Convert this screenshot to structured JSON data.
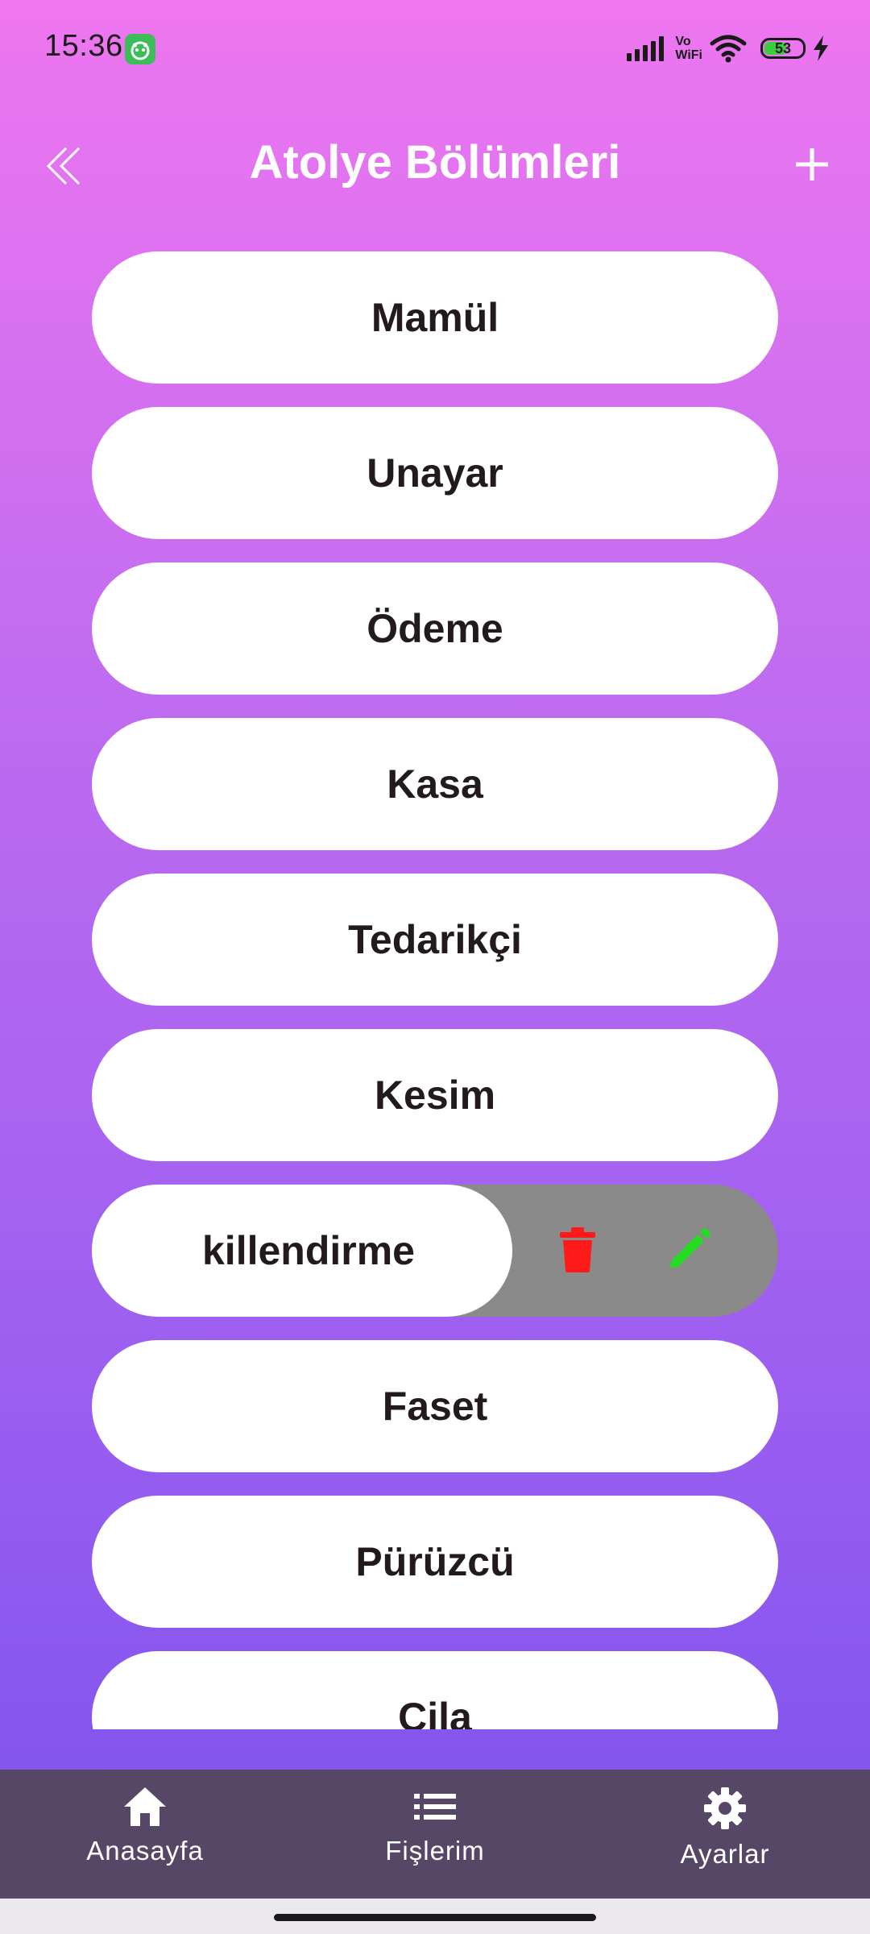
{
  "status_bar": {
    "time": "15:36",
    "network": "Vo WiFi",
    "battery": "53"
  },
  "app_bar": {
    "title": "Atolye Bölümleri",
    "back_icon": "double-chevron-left-icon",
    "add_icon": "plus-icon"
  },
  "sections": [
    {
      "label": "Mamül"
    },
    {
      "label": "Unayar"
    },
    {
      "label": "Ödeme"
    },
    {
      "label": "Kasa"
    },
    {
      "label": "Tedarikçi"
    },
    {
      "label": "Kesim"
    },
    {
      "label": "killendirme",
      "swiped": true
    },
    {
      "label": "Faset"
    },
    {
      "label": "Pürüzcü"
    },
    {
      "label": "Cila"
    }
  ],
  "swipe_actions": {
    "delete_icon": "trash-icon",
    "edit_icon": "pencil-icon",
    "delete_color": "#ff1a1a",
    "edit_color": "#22dd22"
  },
  "bottom_nav": {
    "items": [
      {
        "label": "Anasayfa",
        "icon": "home-icon"
      },
      {
        "label": "Fişlerim",
        "icon": "list-icon"
      },
      {
        "label": "Ayarlar",
        "icon": "gear-icon"
      }
    ]
  },
  "colors": {
    "gradient_top": "#ef76f0",
    "gradient_bottom": "#7a52ee",
    "nav_background": "#574767",
    "swipe_background": "#8a8a8a"
  }
}
